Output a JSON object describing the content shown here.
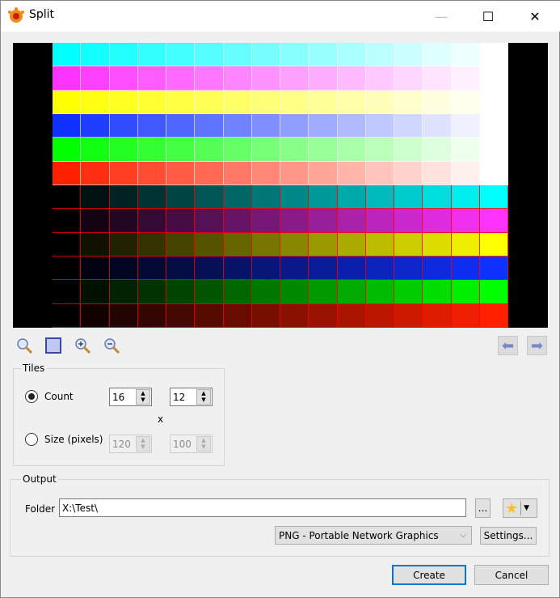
{
  "window": {
    "title": "Split",
    "minimize": "—",
    "maximize": "☐",
    "close": "✕"
  },
  "preview": {
    "columns": 16,
    "rows": 12,
    "row_colors": [
      "#00ffff",
      "#ff33ff",
      "#ffff00",
      "#1030ff",
      "#00ff00",
      "#ff2000",
      "#00ffff",
      "#ff33ff",
      "#ffff00",
      "#1030ff",
      "#00ff00",
      "#ff2000"
    ]
  },
  "tiles": {
    "legend": "Tiles",
    "count_label": "Count",
    "count_selected": true,
    "count_x": "16",
    "count_y": "12",
    "separator": "x",
    "size_label": "Size (pixels)",
    "size_x": "120",
    "size_y": "100"
  },
  "output": {
    "legend": "Output",
    "folder_label": "Folder",
    "folder_value": "X:\\Test\\",
    "browse_label": "...",
    "format_value": "PNG - Portable Network Graphics",
    "settings_label": "Settings..."
  },
  "buttons": {
    "create": "Create",
    "cancel": "Cancel"
  }
}
